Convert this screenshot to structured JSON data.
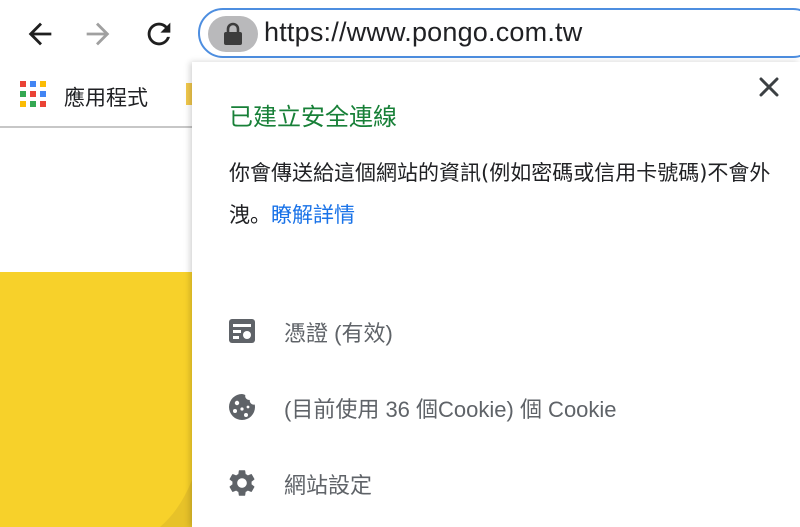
{
  "toolbar": {
    "back_icon": "back-arrow-icon",
    "forward_icon": "forward-arrow-icon",
    "reload_icon": "reload-icon",
    "url": "https://www.pongo.com.tw",
    "lock_icon": "lock-icon"
  },
  "bookmarks": {
    "apps_icon": "apps-grid-icon",
    "apps_label": "應用程式"
  },
  "popup": {
    "title": "已建立安全連線",
    "description": "你會傳送給這個網站的資訊(例如密碼或信用卡號碼)不會外洩。",
    "learn_more": "瞭解詳情",
    "close_icon": "close-icon",
    "items": [
      {
        "icon": "certificate-icon",
        "label": "憑證 (有效)"
      },
      {
        "icon": "cookie-icon",
        "label": "(目前使用 36 個Cookie) 個 Cookie"
      },
      {
        "icon": "gear-icon",
        "label": "網站設定"
      }
    ]
  },
  "colors": {
    "secure_green": "#188038",
    "link_blue": "#1a73e8",
    "omnibox_border": "#4d8ee0",
    "page_yellow": "#f7d12a"
  }
}
